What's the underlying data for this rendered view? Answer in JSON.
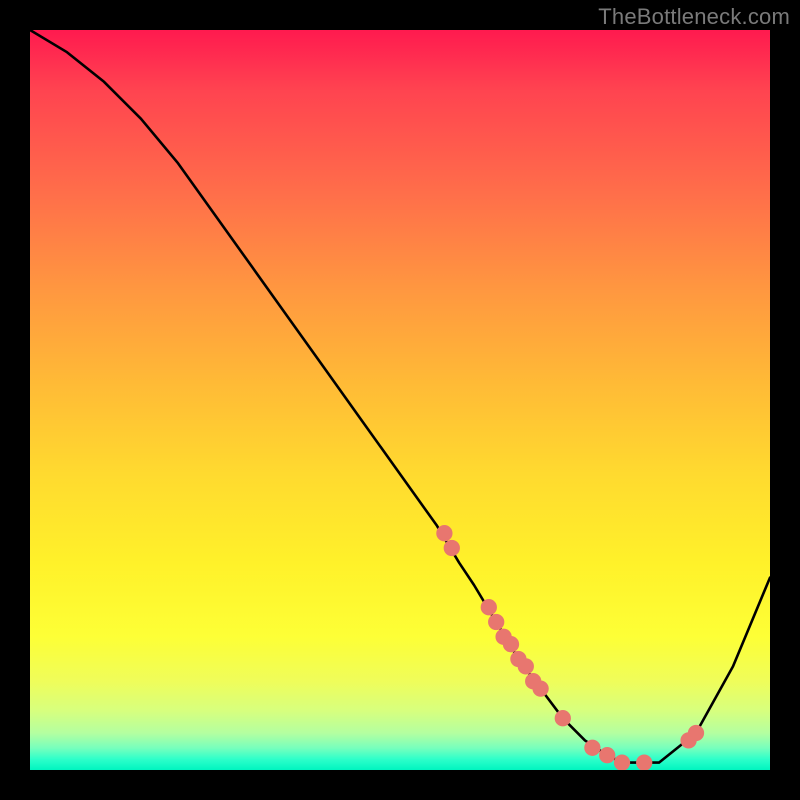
{
  "watermark": "TheBottleneck.com",
  "chart_data": {
    "type": "line",
    "title": "",
    "xlabel": "",
    "ylabel": "",
    "xlim": [
      0,
      100
    ],
    "ylim": [
      0,
      100
    ],
    "grid": false,
    "series": [
      {
        "name": "curve",
        "x": [
          0,
          5,
          10,
          15,
          20,
          25,
          30,
          35,
          40,
          45,
          50,
          55,
          58,
          60,
          63,
          66,
          69,
          72,
          75,
          78,
          80,
          85,
          90,
          95,
          100
        ],
        "y": [
          100,
          97,
          93,
          88,
          82,
          75,
          68,
          61,
          54,
          47,
          40,
          33,
          28,
          25,
          20,
          15,
          11,
          7,
          4,
          2,
          1,
          1,
          5,
          14,
          26
        ]
      }
    ],
    "scatter": {
      "name": "dots",
      "x": [
        56,
        57,
        62,
        63,
        64,
        65,
        66,
        67,
        68,
        69,
        72,
        76,
        78,
        80,
        83,
        89,
        90
      ],
      "y": [
        32,
        30,
        22,
        20,
        18,
        17,
        15,
        14,
        12,
        11,
        7,
        3,
        2,
        1,
        1,
        4,
        5
      ]
    },
    "background_gradient": {
      "stops": [
        {
          "pos": 0,
          "color": "#ff1a4f"
        },
        {
          "pos": 50,
          "color": "#ffda2f"
        },
        {
          "pos": 90,
          "color": "#effd5a"
        },
        {
          "pos": 100,
          "color": "#00f5c0"
        }
      ]
    }
  }
}
